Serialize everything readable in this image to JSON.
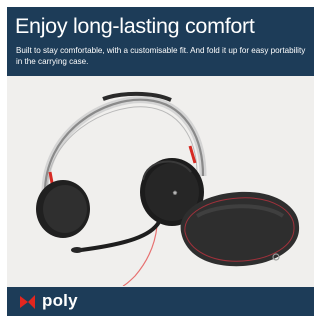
{
  "banner": {
    "headline": "Enjoy long-lasting comfort",
    "description": "Built to stay comfortable, with a customisable fit. And fold it up for easy portability in the carrying case."
  },
  "product_image": {
    "subject": "headset-and-carrying-case"
  },
  "footer": {
    "brand": "poly",
    "logo_icon": "poly-propeller-logo-icon"
  },
  "colors": {
    "banner_bg": "#1d3c58",
    "footer_bg": "#1d3c58",
    "scene_bg": "#f0efed",
    "accent": "#e4261f"
  }
}
